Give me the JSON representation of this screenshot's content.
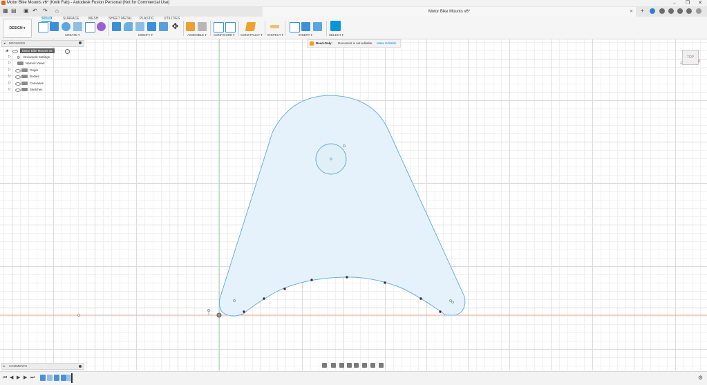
{
  "window": {
    "title": "Motor Bike Mounts v6* (Kwik Fab) - Autodesk Fusion Personal (Not for Commercial Use)",
    "controls": [
      "–",
      "❐",
      "✕"
    ]
  },
  "document_tab": {
    "label": "Motor Bike Mounts v6*",
    "close": "✕"
  },
  "ribbon": {
    "workspace_button": "DESIGN ▾",
    "tabs": [
      "SOLID",
      "SURFACE",
      "MESH",
      "SHEET METAL",
      "PLASTIC",
      "UTILITIES"
    ],
    "active_tab": "SOLID",
    "groups": [
      "CREATE ▾",
      "MODIFY ▾",
      "ASSEMBLE ▾",
      "CONFIGURE ▾",
      "CONSTRUCT ▾",
      "INSPECT ▾",
      "INSERT ▾",
      "SELECT ▾"
    ]
  },
  "notice": {
    "label": "Read-Only:",
    "message": "Document is not editable",
    "action": "Make Editable"
  },
  "browser": {
    "title": "BROWSER",
    "root": "Motor Bike Mounts v6",
    "items": [
      "Document Settings",
      "Named Views",
      "Origin",
      "Bodies",
      "Canvases",
      "Sketches"
    ]
  },
  "comments": {
    "title": "COMMENTS"
  },
  "viewcube": {
    "face": "TOP",
    "axis_x": "X",
    "axis_z": "Z"
  },
  "timeline": {
    "controls": [
      "⏮",
      "◀",
      "▶",
      "▶",
      "⏭"
    ]
  },
  "colors": {
    "accent": "#0696d7",
    "sketch_line": "#67b1d6",
    "sketch_fill": "#e6f2fb",
    "axis_red": "#e8a08a",
    "axis_green": "#a7d7a7"
  }
}
